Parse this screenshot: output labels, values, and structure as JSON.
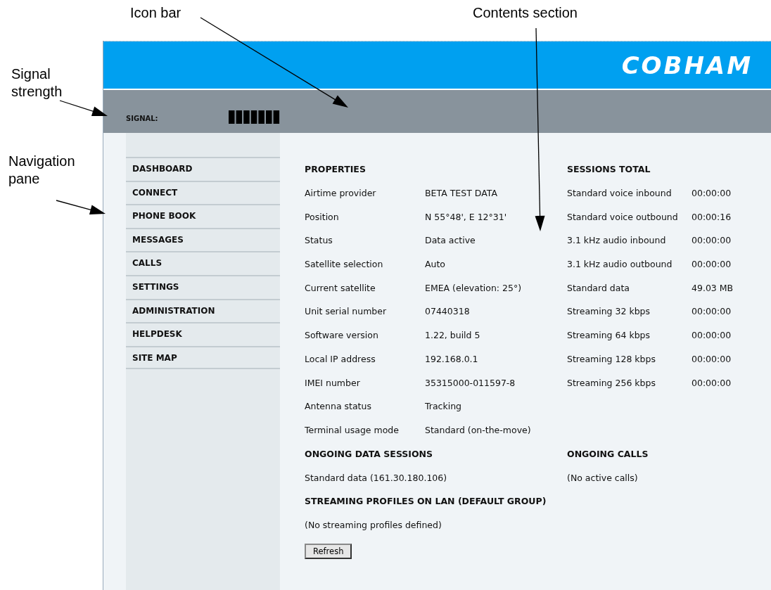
{
  "callouts": [
    {
      "label": "Icon bar"
    },
    {
      "label": "Contents section"
    },
    {
      "label": "Signal strength"
    },
    {
      "label": "Navigation pane"
    }
  ],
  "header": {
    "logo": "COBHAM"
  },
  "icon_bar": {
    "signal_label": "SIGNAL:"
  },
  "navigation": [
    {
      "label": "DASHBOARD"
    },
    {
      "label": "CONNECT"
    },
    {
      "label": "PHONE BOOK"
    },
    {
      "label": "MESSAGES"
    },
    {
      "label": "CALLS"
    },
    {
      "label": "SETTINGS"
    },
    {
      "label": "ADMINISTRATION"
    },
    {
      "label": "HELPDESK"
    },
    {
      "label": "SITE MAP"
    }
  ],
  "properties": {
    "title": "PROPERTIES",
    "rows": [
      {
        "label": "Airtime provider",
        "value": "BETA TEST DATA"
      },
      {
        "label": "Position",
        "value": "N 55°48', E 12°31'"
      },
      {
        "label": "Status",
        "value": "Data active"
      },
      {
        "label": "Satellite selection",
        "value": "Auto"
      },
      {
        "label": "Current satellite",
        "value": "EMEA (elevation: 25°)"
      },
      {
        "label": "Unit serial number",
        "value": "07440318"
      },
      {
        "label": "Software version",
        "value": "1.22, build 5"
      },
      {
        "label": "Local IP address",
        "value": "192.168.0.1"
      },
      {
        "label": "IMEI number",
        "value": "35315000-011597-8"
      },
      {
        "label": "Antenna status",
        "value": "Tracking"
      },
      {
        "label": "Terminal usage mode",
        "value": "Standard (on-the-move)"
      }
    ]
  },
  "sessions_total": {
    "title": "SESSIONS TOTAL",
    "rows": [
      {
        "label": "Standard voice inbound",
        "value": "00:00:00"
      },
      {
        "label": "Standard voice outbound",
        "value": "00:00:16"
      },
      {
        "label": "3.1 kHz audio inbound",
        "value": "00:00:00"
      },
      {
        "label": "3.1 kHz audio outbound",
        "value": "00:00:00"
      },
      {
        "label": "Standard data",
        "value": "49.03 MB"
      },
      {
        "label": "Streaming 32 kbps",
        "value": "00:00:00"
      },
      {
        "label": "Streaming 64 kbps",
        "value": "00:00:00"
      },
      {
        "label": "Streaming 128 kbps",
        "value": "00:00:00"
      },
      {
        "label": "Streaming 256 kbps",
        "value": "00:00:00"
      }
    ]
  },
  "ongoing_data_sessions": {
    "title": "ONGOING DATA SESSIONS",
    "text": "Standard data (161.30.180.106)"
  },
  "ongoing_calls": {
    "title": "ONGOING CALLS",
    "text": "(No active calls)"
  },
  "streaming_profiles": {
    "title": "STREAMING PROFILES ON LAN (DEFAULT GROUP)",
    "text": "(No streaming profiles defined)"
  },
  "refresh_button": "Refresh"
}
